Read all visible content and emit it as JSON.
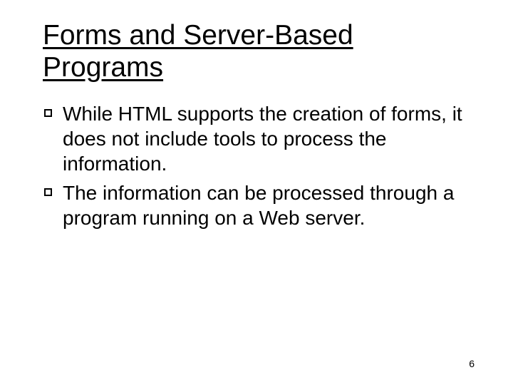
{
  "title": "Forms and Server-Based Programs",
  "bullets": [
    "While HTML supports the creation of forms, it does not include tools to process the information.",
    "The information can be processed through a program running on a Web server."
  ],
  "page_number": "6"
}
